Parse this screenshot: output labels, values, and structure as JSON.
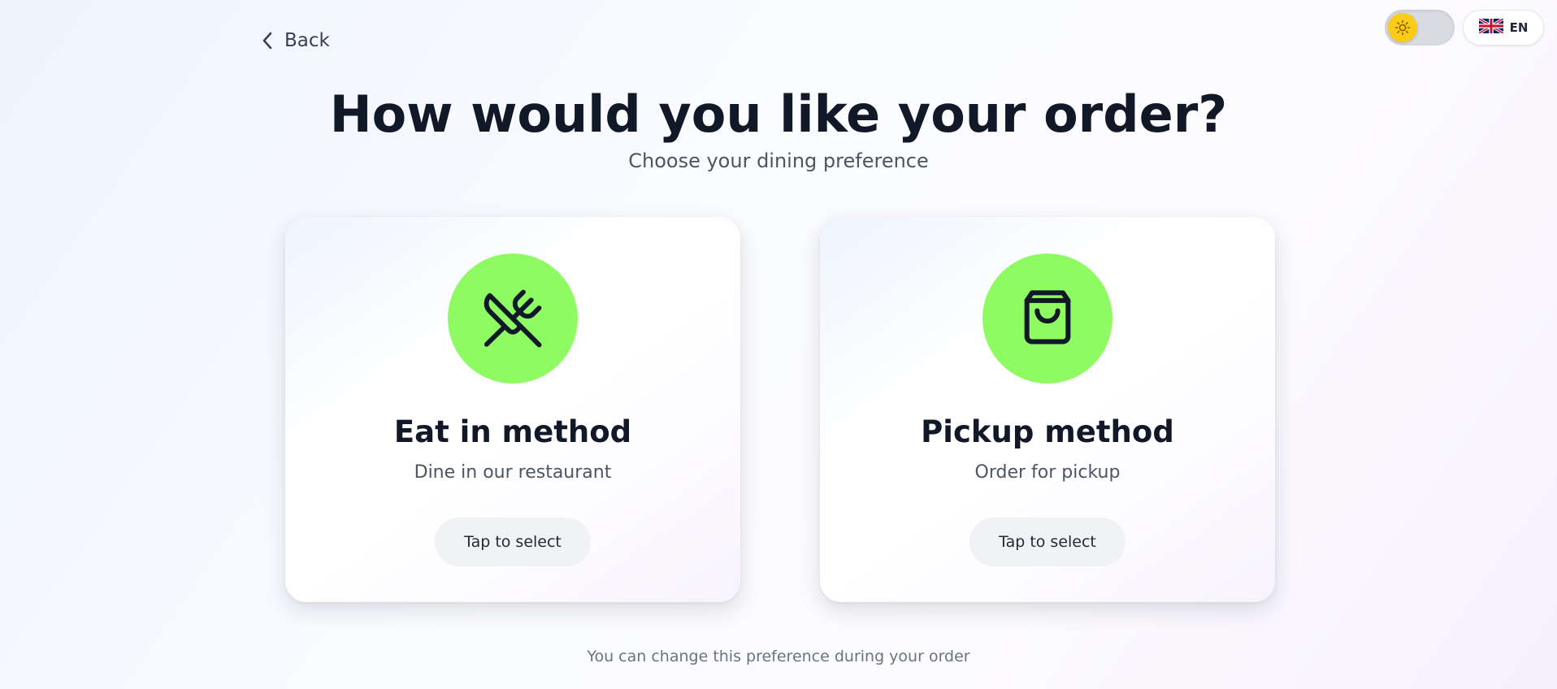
{
  "header": {
    "back_label": "Back",
    "back_icon": "chevron-left-icon",
    "theme_icon": "sun-icon",
    "language": {
      "label": "EN",
      "flag_icon": "uk-flag-icon"
    }
  },
  "main": {
    "title": "How would you like your order?",
    "subtitle": "Choose your dining preference",
    "options": [
      {
        "title": "Eat in method",
        "description": "Dine in our restaurant",
        "button_label": "Tap to select",
        "icon": "utensils-crossed-icon"
      },
      {
        "title": "Pickup method",
        "description": "Order for pickup",
        "button_label": "Tap to select",
        "icon": "shopping-bag-icon"
      }
    ]
  },
  "footer": {
    "note": "You can change this preference during your order"
  },
  "colors": {
    "accent": "#8ffb63",
    "text_primary": "#111827",
    "text_secondary": "#4b5563",
    "toggle_knob": "#facc15"
  }
}
